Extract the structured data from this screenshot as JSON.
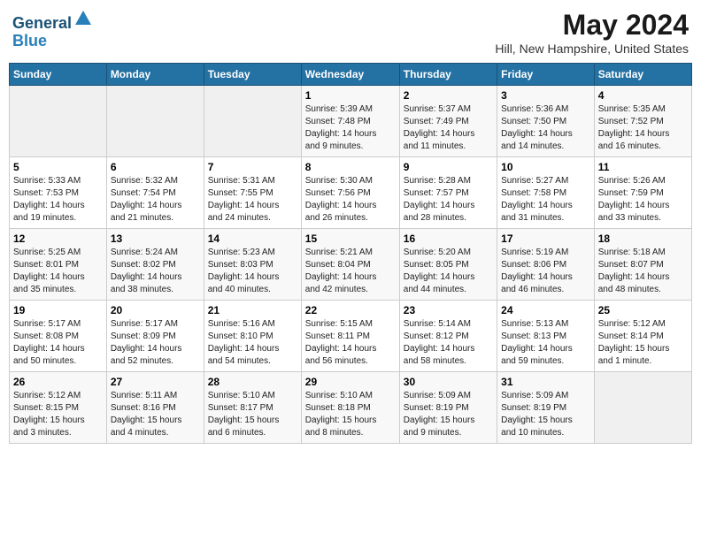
{
  "header": {
    "logo_line1": "General",
    "logo_line2": "Blue",
    "month": "May 2024",
    "location": "Hill, New Hampshire, United States"
  },
  "weekdays": [
    "Sunday",
    "Monday",
    "Tuesday",
    "Wednesday",
    "Thursday",
    "Friday",
    "Saturday"
  ],
  "weeks": [
    [
      {
        "day": "",
        "info": ""
      },
      {
        "day": "",
        "info": ""
      },
      {
        "day": "",
        "info": ""
      },
      {
        "day": "1",
        "info": "Sunrise: 5:39 AM\nSunset: 7:48 PM\nDaylight: 14 hours\nand 9 minutes."
      },
      {
        "day": "2",
        "info": "Sunrise: 5:37 AM\nSunset: 7:49 PM\nDaylight: 14 hours\nand 11 minutes."
      },
      {
        "day": "3",
        "info": "Sunrise: 5:36 AM\nSunset: 7:50 PM\nDaylight: 14 hours\nand 14 minutes."
      },
      {
        "day": "4",
        "info": "Sunrise: 5:35 AM\nSunset: 7:52 PM\nDaylight: 14 hours\nand 16 minutes."
      }
    ],
    [
      {
        "day": "5",
        "info": "Sunrise: 5:33 AM\nSunset: 7:53 PM\nDaylight: 14 hours\nand 19 minutes."
      },
      {
        "day": "6",
        "info": "Sunrise: 5:32 AM\nSunset: 7:54 PM\nDaylight: 14 hours\nand 21 minutes."
      },
      {
        "day": "7",
        "info": "Sunrise: 5:31 AM\nSunset: 7:55 PM\nDaylight: 14 hours\nand 24 minutes."
      },
      {
        "day": "8",
        "info": "Sunrise: 5:30 AM\nSunset: 7:56 PM\nDaylight: 14 hours\nand 26 minutes."
      },
      {
        "day": "9",
        "info": "Sunrise: 5:28 AM\nSunset: 7:57 PM\nDaylight: 14 hours\nand 28 minutes."
      },
      {
        "day": "10",
        "info": "Sunrise: 5:27 AM\nSunset: 7:58 PM\nDaylight: 14 hours\nand 31 minutes."
      },
      {
        "day": "11",
        "info": "Sunrise: 5:26 AM\nSunset: 7:59 PM\nDaylight: 14 hours\nand 33 minutes."
      }
    ],
    [
      {
        "day": "12",
        "info": "Sunrise: 5:25 AM\nSunset: 8:01 PM\nDaylight: 14 hours\nand 35 minutes."
      },
      {
        "day": "13",
        "info": "Sunrise: 5:24 AM\nSunset: 8:02 PM\nDaylight: 14 hours\nand 38 minutes."
      },
      {
        "day": "14",
        "info": "Sunrise: 5:23 AM\nSunset: 8:03 PM\nDaylight: 14 hours\nand 40 minutes."
      },
      {
        "day": "15",
        "info": "Sunrise: 5:21 AM\nSunset: 8:04 PM\nDaylight: 14 hours\nand 42 minutes."
      },
      {
        "day": "16",
        "info": "Sunrise: 5:20 AM\nSunset: 8:05 PM\nDaylight: 14 hours\nand 44 minutes."
      },
      {
        "day": "17",
        "info": "Sunrise: 5:19 AM\nSunset: 8:06 PM\nDaylight: 14 hours\nand 46 minutes."
      },
      {
        "day": "18",
        "info": "Sunrise: 5:18 AM\nSunset: 8:07 PM\nDaylight: 14 hours\nand 48 minutes."
      }
    ],
    [
      {
        "day": "19",
        "info": "Sunrise: 5:17 AM\nSunset: 8:08 PM\nDaylight: 14 hours\nand 50 minutes."
      },
      {
        "day": "20",
        "info": "Sunrise: 5:17 AM\nSunset: 8:09 PM\nDaylight: 14 hours\nand 52 minutes."
      },
      {
        "day": "21",
        "info": "Sunrise: 5:16 AM\nSunset: 8:10 PM\nDaylight: 14 hours\nand 54 minutes."
      },
      {
        "day": "22",
        "info": "Sunrise: 5:15 AM\nSunset: 8:11 PM\nDaylight: 14 hours\nand 56 minutes."
      },
      {
        "day": "23",
        "info": "Sunrise: 5:14 AM\nSunset: 8:12 PM\nDaylight: 14 hours\nand 58 minutes."
      },
      {
        "day": "24",
        "info": "Sunrise: 5:13 AM\nSunset: 8:13 PM\nDaylight: 14 hours\nand 59 minutes."
      },
      {
        "day": "25",
        "info": "Sunrise: 5:12 AM\nSunset: 8:14 PM\nDaylight: 15 hours\nand 1 minute."
      }
    ],
    [
      {
        "day": "26",
        "info": "Sunrise: 5:12 AM\nSunset: 8:15 PM\nDaylight: 15 hours\nand 3 minutes."
      },
      {
        "day": "27",
        "info": "Sunrise: 5:11 AM\nSunset: 8:16 PM\nDaylight: 15 hours\nand 4 minutes."
      },
      {
        "day": "28",
        "info": "Sunrise: 5:10 AM\nSunset: 8:17 PM\nDaylight: 15 hours\nand 6 minutes."
      },
      {
        "day": "29",
        "info": "Sunrise: 5:10 AM\nSunset: 8:18 PM\nDaylight: 15 hours\nand 8 minutes."
      },
      {
        "day": "30",
        "info": "Sunrise: 5:09 AM\nSunset: 8:19 PM\nDaylight: 15 hours\nand 9 minutes."
      },
      {
        "day": "31",
        "info": "Sunrise: 5:09 AM\nSunset: 8:19 PM\nDaylight: 15 hours\nand 10 minutes."
      },
      {
        "day": "",
        "info": ""
      }
    ]
  ]
}
